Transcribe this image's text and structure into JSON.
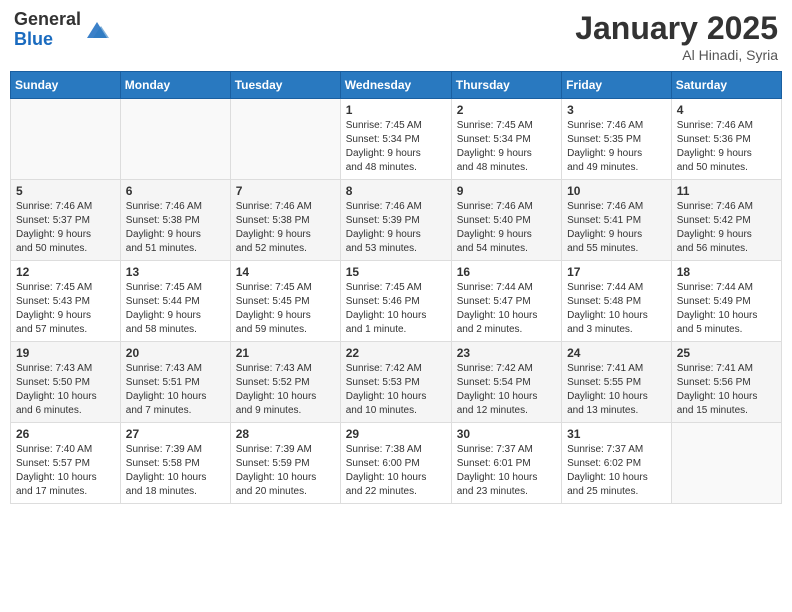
{
  "header": {
    "logo_general": "General",
    "logo_blue": "Blue",
    "month_year": "January 2025",
    "location": "Al Hinadi, Syria"
  },
  "weekdays": [
    "Sunday",
    "Monday",
    "Tuesday",
    "Wednesday",
    "Thursday",
    "Friday",
    "Saturday"
  ],
  "weeks": [
    [
      {
        "day": "",
        "info": ""
      },
      {
        "day": "",
        "info": ""
      },
      {
        "day": "",
        "info": ""
      },
      {
        "day": "1",
        "info": "Sunrise: 7:45 AM\nSunset: 5:34 PM\nDaylight: 9 hours\nand 48 minutes."
      },
      {
        "day": "2",
        "info": "Sunrise: 7:45 AM\nSunset: 5:34 PM\nDaylight: 9 hours\nand 48 minutes."
      },
      {
        "day": "3",
        "info": "Sunrise: 7:46 AM\nSunset: 5:35 PM\nDaylight: 9 hours\nand 49 minutes."
      },
      {
        "day": "4",
        "info": "Sunrise: 7:46 AM\nSunset: 5:36 PM\nDaylight: 9 hours\nand 50 minutes."
      }
    ],
    [
      {
        "day": "5",
        "info": "Sunrise: 7:46 AM\nSunset: 5:37 PM\nDaylight: 9 hours\nand 50 minutes."
      },
      {
        "day": "6",
        "info": "Sunrise: 7:46 AM\nSunset: 5:38 PM\nDaylight: 9 hours\nand 51 minutes."
      },
      {
        "day": "7",
        "info": "Sunrise: 7:46 AM\nSunset: 5:38 PM\nDaylight: 9 hours\nand 52 minutes."
      },
      {
        "day": "8",
        "info": "Sunrise: 7:46 AM\nSunset: 5:39 PM\nDaylight: 9 hours\nand 53 minutes."
      },
      {
        "day": "9",
        "info": "Sunrise: 7:46 AM\nSunset: 5:40 PM\nDaylight: 9 hours\nand 54 minutes."
      },
      {
        "day": "10",
        "info": "Sunrise: 7:46 AM\nSunset: 5:41 PM\nDaylight: 9 hours\nand 55 minutes."
      },
      {
        "day": "11",
        "info": "Sunrise: 7:46 AM\nSunset: 5:42 PM\nDaylight: 9 hours\nand 56 minutes."
      }
    ],
    [
      {
        "day": "12",
        "info": "Sunrise: 7:45 AM\nSunset: 5:43 PM\nDaylight: 9 hours\nand 57 minutes."
      },
      {
        "day": "13",
        "info": "Sunrise: 7:45 AM\nSunset: 5:44 PM\nDaylight: 9 hours\nand 58 minutes."
      },
      {
        "day": "14",
        "info": "Sunrise: 7:45 AM\nSunset: 5:45 PM\nDaylight: 9 hours\nand 59 minutes."
      },
      {
        "day": "15",
        "info": "Sunrise: 7:45 AM\nSunset: 5:46 PM\nDaylight: 10 hours\nand 1 minute."
      },
      {
        "day": "16",
        "info": "Sunrise: 7:44 AM\nSunset: 5:47 PM\nDaylight: 10 hours\nand 2 minutes."
      },
      {
        "day": "17",
        "info": "Sunrise: 7:44 AM\nSunset: 5:48 PM\nDaylight: 10 hours\nand 3 minutes."
      },
      {
        "day": "18",
        "info": "Sunrise: 7:44 AM\nSunset: 5:49 PM\nDaylight: 10 hours\nand 5 minutes."
      }
    ],
    [
      {
        "day": "19",
        "info": "Sunrise: 7:43 AM\nSunset: 5:50 PM\nDaylight: 10 hours\nand 6 minutes."
      },
      {
        "day": "20",
        "info": "Sunrise: 7:43 AM\nSunset: 5:51 PM\nDaylight: 10 hours\nand 7 minutes."
      },
      {
        "day": "21",
        "info": "Sunrise: 7:43 AM\nSunset: 5:52 PM\nDaylight: 10 hours\nand 9 minutes."
      },
      {
        "day": "22",
        "info": "Sunrise: 7:42 AM\nSunset: 5:53 PM\nDaylight: 10 hours\nand 10 minutes."
      },
      {
        "day": "23",
        "info": "Sunrise: 7:42 AM\nSunset: 5:54 PM\nDaylight: 10 hours\nand 12 minutes."
      },
      {
        "day": "24",
        "info": "Sunrise: 7:41 AM\nSunset: 5:55 PM\nDaylight: 10 hours\nand 13 minutes."
      },
      {
        "day": "25",
        "info": "Sunrise: 7:41 AM\nSunset: 5:56 PM\nDaylight: 10 hours\nand 15 minutes."
      }
    ],
    [
      {
        "day": "26",
        "info": "Sunrise: 7:40 AM\nSunset: 5:57 PM\nDaylight: 10 hours\nand 17 minutes."
      },
      {
        "day": "27",
        "info": "Sunrise: 7:39 AM\nSunset: 5:58 PM\nDaylight: 10 hours\nand 18 minutes."
      },
      {
        "day": "28",
        "info": "Sunrise: 7:39 AM\nSunset: 5:59 PM\nDaylight: 10 hours\nand 20 minutes."
      },
      {
        "day": "29",
        "info": "Sunrise: 7:38 AM\nSunset: 6:00 PM\nDaylight: 10 hours\nand 22 minutes."
      },
      {
        "day": "30",
        "info": "Sunrise: 7:37 AM\nSunset: 6:01 PM\nDaylight: 10 hours\nand 23 minutes."
      },
      {
        "day": "31",
        "info": "Sunrise: 7:37 AM\nSunset: 6:02 PM\nDaylight: 10 hours\nand 25 minutes."
      },
      {
        "day": "",
        "info": ""
      }
    ]
  ]
}
